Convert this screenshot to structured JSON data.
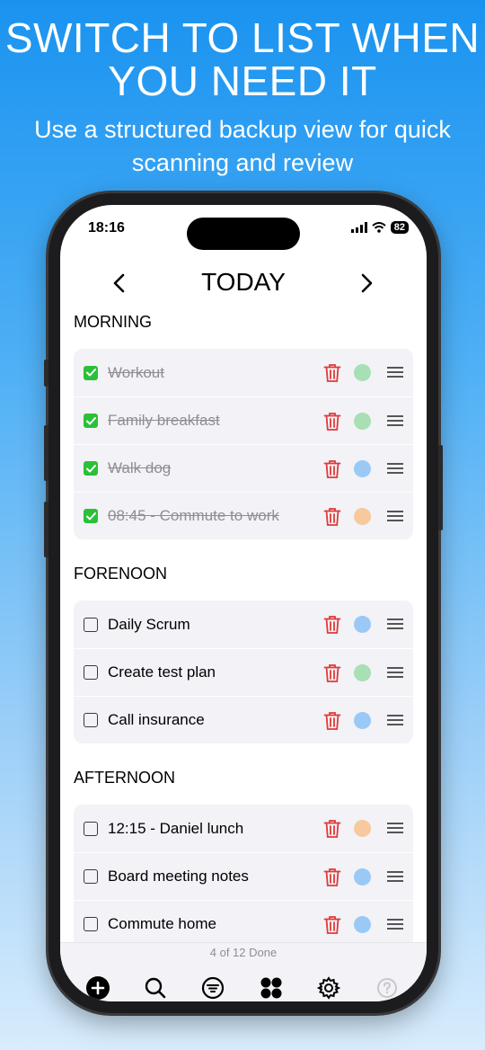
{
  "promo": {
    "headline_line1": "SWITCH TO LIST WHEN",
    "headline_line2": "YOU NEED IT",
    "subline_line1": "Use a structured backup view for quick",
    "subline_line2": "scanning and review"
  },
  "status_bar": {
    "time": "18:16",
    "battery": "82"
  },
  "nav": {
    "title": "TODAY",
    "prev_icon": "chevron-left-icon",
    "next_icon": "chevron-right-icon"
  },
  "colors": {
    "accent_green": "#2ac038",
    "trash_red": "#e03a3a",
    "dot_green": "#a8dfb4",
    "dot_blue": "#9ac9f5",
    "dot_orange": "#f7c99c"
  },
  "sections": [
    {
      "title": "MORNING",
      "tasks": [
        {
          "label": "Workout",
          "done": true,
          "color": "green"
        },
        {
          "label": "Family breakfast",
          "done": true,
          "color": "green"
        },
        {
          "label": "Walk dog",
          "done": true,
          "color": "blue"
        },
        {
          "label": "08:45 - Commute to work",
          "done": true,
          "color": "orange"
        }
      ]
    },
    {
      "title": "FORENOON",
      "tasks": [
        {
          "label": "Daily Scrum",
          "done": false,
          "color": "blue"
        },
        {
          "label": "Create test plan",
          "done": false,
          "color": "green"
        },
        {
          "label": "Call insurance",
          "done": false,
          "color": "blue"
        }
      ]
    },
    {
      "title": "AFTERNOON",
      "tasks": [
        {
          "label": "12:15 - Daniel lunch",
          "done": false,
          "color": "orange"
        },
        {
          "label": "Board meeting notes",
          "done": false,
          "color": "blue"
        },
        {
          "label": "Commute home",
          "done": false,
          "color": "blue"
        }
      ]
    }
  ],
  "footer": {
    "done_count": "4 of 12 Done",
    "tabs": [
      "add-icon",
      "search-icon",
      "filter-icon",
      "grid-icon",
      "gear-icon",
      "help-icon"
    ]
  }
}
